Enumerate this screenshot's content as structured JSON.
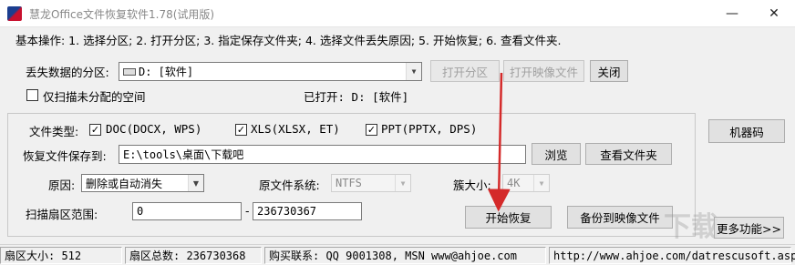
{
  "window": {
    "title": "慧龙Office文件恢复软件1.78(试用版)",
    "minimize_icon": "minimize-icon",
    "close_icon": "close-icon"
  },
  "instructions": "基本操作: 1. 选择分区; 2. 打开分区; 3. 指定保存文件夹; 4. 选择文件丢失原因; 5. 开始恢复; 6. 查看文件夹.",
  "partition": {
    "label": "丢失数据的分区:",
    "value": "D: [软件]",
    "open_partition_button": "打开分区",
    "open_image_button": "打开映像文件",
    "close_button": "关闭",
    "scan_unallocated_label": "仅扫描未分配的空间",
    "scan_unallocated_checked": false,
    "opened_label": "已打开: D: [软件]"
  },
  "file_types": {
    "label": "文件类型:",
    "doc": {
      "label": "DOC(DOCX, WPS)",
      "checked": true
    },
    "xls": {
      "label": "XLS(XLSX, ET)",
      "checked": true
    },
    "ppt": {
      "label": "PPT(PPTX, DPS)",
      "checked": true
    }
  },
  "save_folder": {
    "label": "恢复文件保存到:",
    "value": "E:\\tools\\桌面\\下载吧",
    "browse_button": "浏览",
    "view_folder_button": "查看文件夹"
  },
  "options": {
    "reason_label": "原因:",
    "reason_value": "删除或自动消失",
    "fs_label": "原文件系统:",
    "fs_value": "NTFS",
    "cluster_label": "簇大小:",
    "cluster_value": "4K"
  },
  "scan_range": {
    "label": "扫描扇区范围:",
    "start": "0",
    "separator": "-",
    "end": "236730367",
    "start_recovery_button": "开始恢复",
    "backup_image_button": "备份到映像文件"
  },
  "side": {
    "machine_code_button": "机器码",
    "more_button": "更多功能>>"
  },
  "status": {
    "sector_size": "扇区大小: 512",
    "sector_total": "扇区总数: 236730368",
    "purchase": "购买联系: QQ 9001308, MSN www@ahjoe.com",
    "url": "http://www.ahjoe.com/datrescusoft.asp"
  },
  "colors": {
    "annotation_arrow": "#d42a2a"
  }
}
